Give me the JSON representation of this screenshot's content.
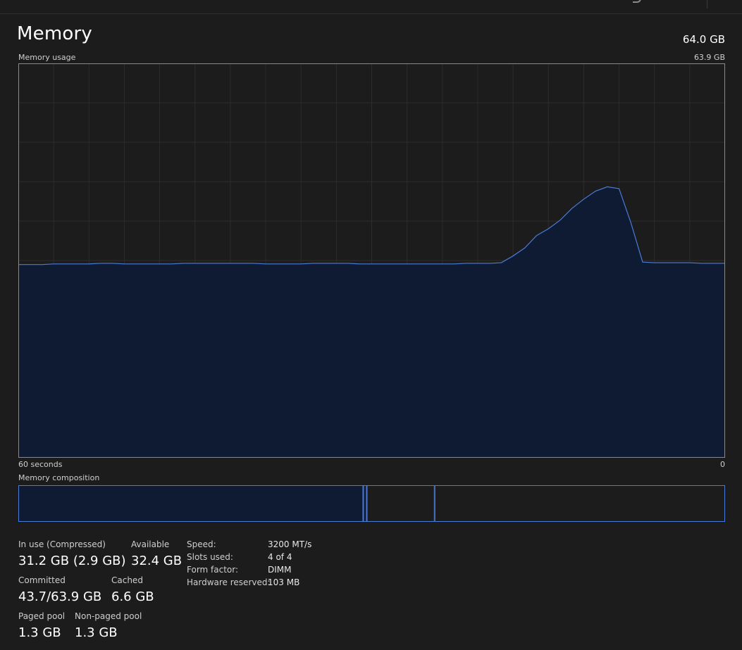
{
  "header": {
    "title": "Memory",
    "total": "64.0 GB",
    "usage_label": "Memory usage",
    "usage_max": "63.9 GB",
    "time_start": "60 seconds",
    "time_end": "0",
    "composition_label": "Memory composition"
  },
  "colors": {
    "accent": "#4a7bd8",
    "fill": "#0f1b33",
    "grid": "#2c2c2c",
    "background": "#1c1c1c"
  },
  "chart_data": {
    "type": "area",
    "x": [
      60,
      59,
      58,
      57,
      56,
      55,
      54,
      53,
      52,
      51,
      50,
      49,
      48,
      47,
      46,
      45,
      44,
      43,
      42,
      41,
      40,
      39,
      38,
      37,
      36,
      35,
      34,
      33,
      32,
      31,
      30,
      29,
      28,
      27,
      26,
      25,
      24,
      23,
      22,
      21,
      20,
      19,
      18,
      17,
      16,
      15,
      14,
      13,
      12,
      11,
      10,
      9,
      8,
      7,
      6,
      5,
      4,
      3,
      2,
      1,
      0
    ],
    "values": [
      31.3,
      31.3,
      31.3,
      31.4,
      31.4,
      31.4,
      31.4,
      31.5,
      31.5,
      31.4,
      31.4,
      31.4,
      31.4,
      31.4,
      31.5,
      31.5,
      31.5,
      31.5,
      31.5,
      31.5,
      31.5,
      31.4,
      31.4,
      31.4,
      31.4,
      31.5,
      31.5,
      31.5,
      31.5,
      31.4,
      31.4,
      31.4,
      31.4,
      31.4,
      31.4,
      31.4,
      31.4,
      31.4,
      31.5,
      31.5,
      31.5,
      31.6,
      32.7,
      34.0,
      36.0,
      37.1,
      38.5,
      40.4,
      41.9,
      43.2,
      43.9,
      43.6,
      38.1,
      31.7,
      31.6,
      31.6,
      31.6,
      31.6,
      31.5,
      31.5,
      31.5
    ],
    "ylim": [
      0,
      63.9
    ],
    "xlim": [
      60,
      0
    ],
    "grid": true,
    "grid_vertical_divisions": 20,
    "grid_horizontal_divisions": 10
  },
  "composition": {
    "in_use_fraction": 0.488,
    "modified_fraction": 0.005,
    "standby_fraction": 0.096,
    "free_fraction": 0.411
  },
  "stats": {
    "in_use_label": "In use (Compressed)",
    "in_use_value": "31.2 GB (2.9 GB)",
    "available_label": "Available",
    "available_value": "32.4 GB",
    "committed_label": "Committed",
    "committed_value": "43.7/63.9 GB",
    "cached_label": "Cached",
    "cached_value": "6.6 GB",
    "paged_label": "Paged pool",
    "paged_value": "1.3 GB",
    "nonpaged_label": "Non-paged pool",
    "nonpaged_value": "1.3 GB"
  },
  "specs": {
    "speed_label": "Speed:",
    "speed_value": "3200 MT/s",
    "slots_label": "Slots used:",
    "slots_value": "4 of 4",
    "form_label": "Form factor:",
    "form_value": "DIMM",
    "reserved_label": "Hardware reserved:",
    "reserved_value": "103 MB"
  }
}
